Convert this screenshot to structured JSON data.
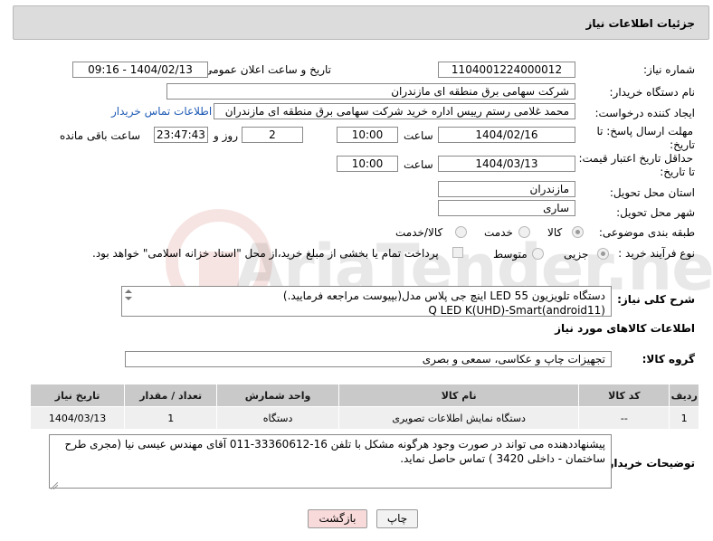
{
  "header": {
    "title": "جزئیات اطلاعات نیاز"
  },
  "fields": {
    "need_number": {
      "label": "شماره نیاز:",
      "value": "1104001224000012"
    },
    "announce_datetime": {
      "label": "تاریخ و ساعت اعلان عمومی:",
      "value": "1404/02/13 - 09:16"
    },
    "buyer_org": {
      "label": "نام دستگاه خریدار:",
      "value": "شرکت سهامی برق منطقه ای مازندران"
    },
    "requester": {
      "label": "ایجاد کننده درخواست:",
      "value": "محمد غلامی رستم رییس اداره خرید شرکت سهامی برق منطقه ای مازندران",
      "contact_link": "اطلاعات تماس خریدار"
    },
    "reply_deadline": {
      "label_line1": "مهلت ارسال پاسخ: تا",
      "label_line2": "تاریخ:",
      "date": "1404/02/16",
      "time_label": "ساعت",
      "time": "10:00",
      "days": "2",
      "days_label": "روز و",
      "remaining": "23:47:43",
      "remaining_label": "ساعت باقی مانده"
    },
    "price_validity": {
      "label_line1": "حداقل تاریخ اعتبار قیمت:",
      "label_line2": "تا تاریخ:",
      "date": "1404/03/13",
      "time_label": "ساعت",
      "time": "10:00"
    },
    "delivery_province": {
      "label": "استان محل تحویل:",
      "value": "مازندران"
    },
    "delivery_city": {
      "label": "شهر محل تحویل:",
      "value": "ساری"
    },
    "category": {
      "label": "طبقه بندی موضوعی:",
      "options": [
        "کالا",
        "خدمت",
        "کالا/خدمت"
      ]
    },
    "purchase_type": {
      "label": "نوع فرآیند خرید :",
      "options": [
        "جزیی",
        "متوسط"
      ],
      "note": "پرداخت تمام یا بخشی از مبلغ خرید،از محل \"اسناد خزانه اسلامی\" خواهد بود."
    }
  },
  "description": {
    "label": "شرح کلی نیاز:",
    "line1": "دستگاه تلویزیون LED 55 اینچ جی پلاس مدل(بپیوست مراجعه فرمایید.)",
    "line2": "Q LED K(UHD)-Smart(android11)"
  },
  "goods_section_title": "اطلاعات کالاهای مورد نیاز",
  "goods_group": {
    "label": "گروه کالا:",
    "value": "تجهیزات چاپ و عکاسی، سمعی و بصری"
  },
  "table": {
    "headers": [
      "ردیف",
      "کد کالا",
      "نام کالا",
      "واحد شمارش",
      "تعداد / مقدار",
      "تاریخ نیاز"
    ],
    "rows": [
      [
        "1",
        "--",
        "دستگاه نمایش اطلاعات تصویری",
        "دستگاه",
        "1",
        "1404/03/13"
      ]
    ]
  },
  "buyer_notes": {
    "label": "توضیحات خریدار:",
    "line1": "پیشنهاددهنده می تواند در صورت وجود هرگونه مشکل با تلفن 16-33360612-011 آقای مهندس عیسی نیا  (مجری طرح",
    "line2": "ساختمان - داخلی 3420 ) تماس حاصل نماید."
  },
  "buttons": {
    "print": "چاپ",
    "back": "بازگشت"
  },
  "watermark": {
    "brand": "AriaTender.neT"
  },
  "colors": {
    "header_bg": "#dcdcdc",
    "link": "#1f5bb5",
    "table_header": "#c9c9c9",
    "table_row": "#efefef",
    "back_button": "#f8dada"
  }
}
